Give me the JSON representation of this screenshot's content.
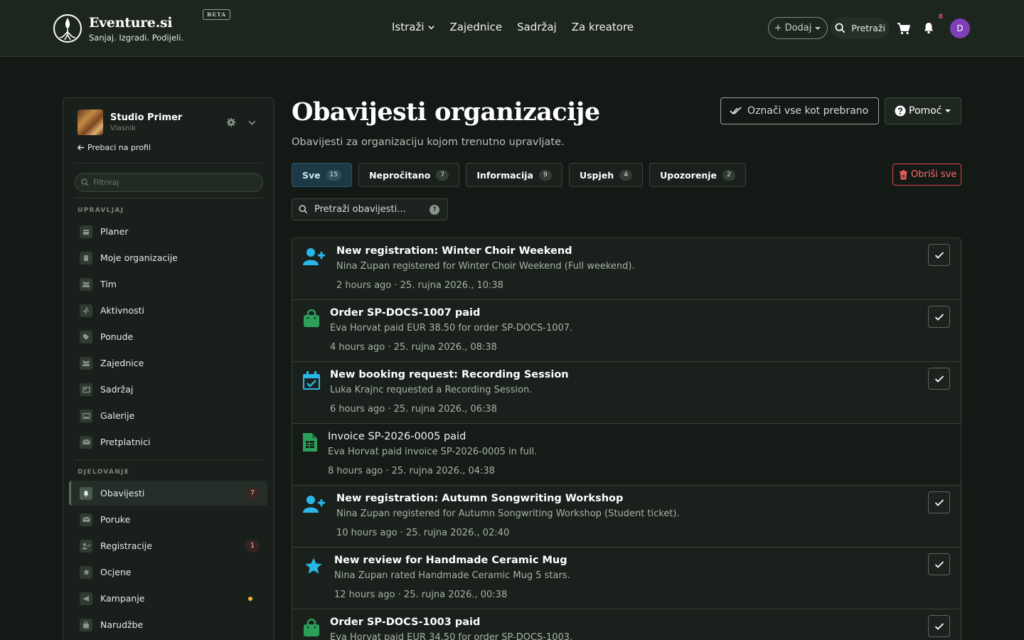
{
  "header": {
    "brand": "Eventure.si",
    "tagline": "Sanjaj. Izgradi. Podijeli.",
    "beta": "BETA",
    "nav": [
      {
        "label": "Istraži"
      },
      {
        "label": "Zajednice"
      },
      {
        "label": "Sadržaj"
      },
      {
        "label": "Za kreatore"
      }
    ],
    "add_label": "+ Dodaj",
    "search_label": "Pretraži",
    "notif_count": "8",
    "avatar_letter": "D"
  },
  "sidebar": {
    "org_name": "Studio Primer",
    "org_role": "Vlasnik",
    "back_label": "Prebaci na profil",
    "filter_placeholder": "Filtriraj",
    "section_manage": "UPRAVLJAJ",
    "section_ops": "DJELOVANJE",
    "manage_items": [
      {
        "label": "Planer",
        "icon": "calendar-icon"
      },
      {
        "label": "Moje organizacije",
        "icon": "building-icon"
      },
      {
        "label": "Tim",
        "icon": "team-icon"
      },
      {
        "label": "Aktivnosti",
        "icon": "running-icon"
      },
      {
        "label": "Ponude",
        "icon": "tag-icon"
      },
      {
        "label": "Zajednice",
        "icon": "people-icon"
      },
      {
        "label": "Sadržaj",
        "icon": "newspaper-icon"
      },
      {
        "label": "Galerije",
        "icon": "images-icon"
      },
      {
        "label": "Pretplatnici",
        "icon": "envelope-icon"
      }
    ],
    "ops_items": [
      {
        "label": "Obavijesti",
        "icon": "bell-icon",
        "badge": "7",
        "active": true
      },
      {
        "label": "Poruke",
        "icon": "envelope-icon"
      },
      {
        "label": "Registracije",
        "icon": "user-check-icon",
        "badge": "1"
      },
      {
        "label": "Ocjene",
        "icon": "star-icon"
      },
      {
        "label": "Kampanje",
        "icon": "megaphone-icon",
        "dot": true
      },
      {
        "label": "Narudžbe",
        "icon": "bag-icon"
      }
    ]
  },
  "main": {
    "title": "Obavijesti organizacije",
    "subtitle": "Obavijesti za organizaciju kojom trenutno upravljate.",
    "mark_all_label": "Označi vse kot prebrano",
    "help_label": "Pomoć",
    "delete_all_label": "Obriši sve",
    "search_placeholder": "Pretraži obavijesti...",
    "tabs": [
      {
        "label": "Sve",
        "count": "15",
        "active": true
      },
      {
        "label": "Nepročitano",
        "count": "7"
      },
      {
        "label": "Informacija",
        "count": "9"
      },
      {
        "label": "Uspjeh",
        "count": "4"
      },
      {
        "label": "Upozorenje",
        "count": "2"
      }
    ],
    "notifications": [
      {
        "title": "New registration: Winter Choir Weekend",
        "body": "Nina Zupan registered for Winter Choir Weekend (Full weekend).",
        "time": "2 hours ago · 25. rujna 2026., 10:38",
        "icon": "user-plus-icon",
        "color": "#29b6e8",
        "unread": true
      },
      {
        "title": "Order SP-DOCS-1007 paid",
        "body": "Eva Horvat paid EUR 38.50 for order SP-DOCS-1007.",
        "time": "4 hours ago · 25. rujna 2026., 08:38",
        "icon": "shopping-bag-icon",
        "color": "#2e9e5b",
        "unread": true
      },
      {
        "title": "New booking request: Recording Session",
        "body": "Luka Krajnc requested a Recording Session.",
        "time": "6 hours ago · 25. rujna 2026., 06:38",
        "icon": "calendar-check-icon",
        "color": "#29b6e8",
        "unread": true
      },
      {
        "title": "Invoice SP-2026-0005 paid",
        "body": "Eva Horvat paid invoice SP-2026-0005 in full.",
        "time": "8 hours ago · 25. rujna 2026., 04:38",
        "icon": "invoice-icon",
        "color": "#2e9e5b",
        "unread": false
      },
      {
        "title": "New registration: Autumn Songwriting Workshop",
        "body": "Nina Zupan registered for Autumn Songwriting Workshop (Student ticket).",
        "time": "10 hours ago · 25. rujna 2026., 02:40",
        "icon": "user-plus-icon",
        "color": "#29b6e8",
        "unread": true
      },
      {
        "title": "New review for Handmade Ceramic Mug",
        "body": "Nina Zupan rated Handmade Ceramic Mug 5 stars.",
        "time": "12 hours ago · 25. rujna 2026., 00:38",
        "icon": "star-icon",
        "color": "#29b6e8",
        "unread": true
      },
      {
        "title": "Order SP-DOCS-1003 paid",
        "body": "Eva Horvat paid EUR 34.50 for order SP-DOCS-1003.",
        "time": "",
        "icon": "shopping-bag-icon",
        "color": "#2e9e5b",
        "unread": true
      }
    ]
  }
}
